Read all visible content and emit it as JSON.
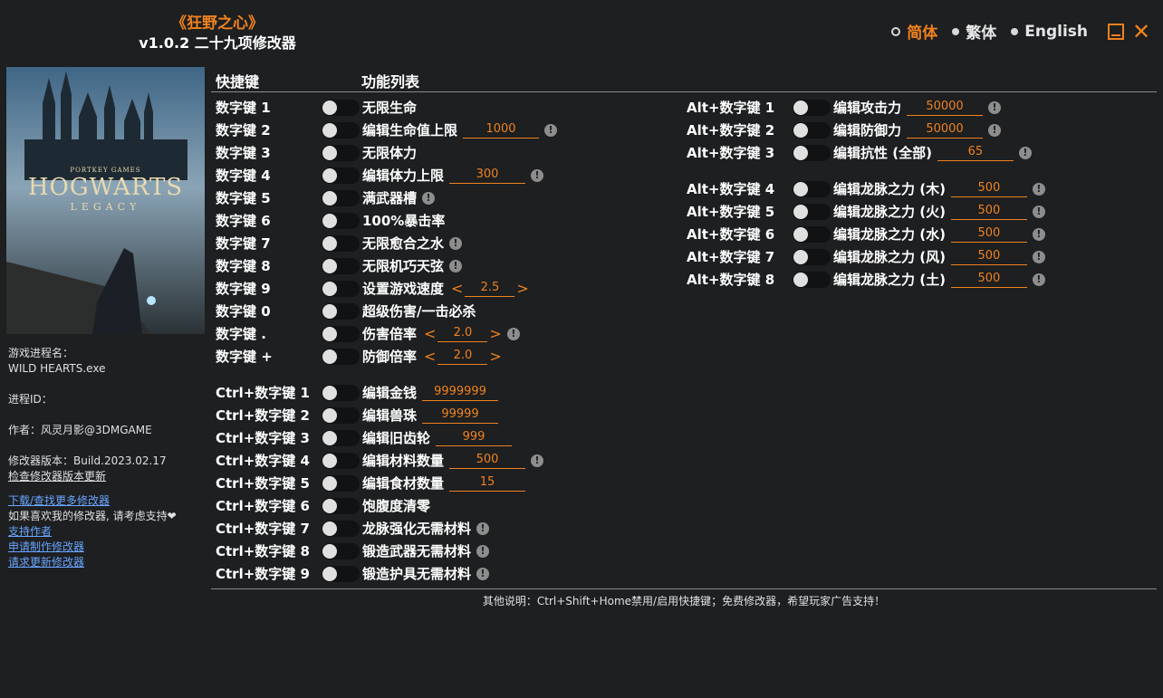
{
  "header": {
    "game_title": "《狂野之心》",
    "subtitle": "v1.0.2 二十九项修改器"
  },
  "languages": [
    "简体",
    "繁体",
    "English"
  ],
  "selected_language": "简体",
  "columns": {
    "hotkey": "快捷键",
    "features": "功能列表"
  },
  "sidebar": {
    "process_label": "游戏进程名：",
    "process_name": "WILD HEARTS.exe",
    "pid_label": "进程ID：",
    "author": "作者：风灵月影@3DMGAME",
    "version": "修改器版本：Build.2023.02.17",
    "check_update": "检查修改器版本更新",
    "download": "下载/查找更多修改器",
    "support_text": "如果喜欢我的修改器, 请考虑支持❤",
    "support_author": "支持作者",
    "request_trainer": "申请制作修改器",
    "request_update": "请求更新修改器"
  },
  "cheats_left": [
    {
      "key": "数字键 1",
      "name": "无限生命",
      "value": null,
      "info": false
    },
    {
      "key": "数字键 2",
      "name": "编辑生命值上限",
      "value": "1000",
      "info": true
    },
    {
      "key": "数字键 3",
      "name": "无限体力",
      "value": null,
      "info": false
    },
    {
      "key": "数字键 4",
      "name": "编辑体力上限",
      "value": "300",
      "info": true
    },
    {
      "key": "数字键 5",
      "name": "满武器槽",
      "value": null,
      "info": true
    },
    {
      "key": "数字键 6",
      "name": "100%暴击率",
      "value": null,
      "info": false
    },
    {
      "key": "数字键 7",
      "name": "无限愈合之水",
      "value": null,
      "info": true
    },
    {
      "key": "数字键 8",
      "name": "无限机巧天弦",
      "value": null,
      "info": true
    },
    {
      "key": "数字键 9",
      "name": "设置游戏速度",
      "stepper": "2.5",
      "info": false
    },
    {
      "key": "数字键 0",
      "name": "超级伤害/一击必杀",
      "value": null,
      "info": false
    },
    {
      "key": "数字键 .",
      "name": "伤害倍率",
      "stepper": "2.0",
      "info": true
    },
    {
      "key": "数字键 +",
      "name": "防御倍率",
      "stepper": "2.0",
      "info": false
    }
  ],
  "cheats_ctrl": [
    {
      "key": "Ctrl+数字键 1",
      "name": "编辑金钱",
      "value": "9999999",
      "info": false
    },
    {
      "key": "Ctrl+数字键 2",
      "name": "编辑兽珠",
      "value": "99999",
      "info": false
    },
    {
      "key": "Ctrl+数字键 3",
      "name": "编辑旧齿轮",
      "value": "999",
      "info": false
    },
    {
      "key": "Ctrl+数字键 4",
      "name": "编辑材料数量",
      "value": "500",
      "info": true
    },
    {
      "key": "Ctrl+数字键 5",
      "name": "编辑食材数量",
      "value": "15",
      "info": false
    },
    {
      "key": "Ctrl+数字键 6",
      "name": "饱腹度清零",
      "value": null,
      "info": false
    },
    {
      "key": "Ctrl+数字键 7",
      "name": "龙脉强化无需材料",
      "value": null,
      "info": true
    },
    {
      "key": "Ctrl+数字键 8",
      "name": "锻造武器无需材料",
      "value": null,
      "info": true
    },
    {
      "key": "Ctrl+数字键 9",
      "name": "锻造护具无需材料",
      "value": null,
      "info": true
    }
  ],
  "cheats_alt1": [
    {
      "key": "Alt+数字键 1",
      "name": "编辑攻击力",
      "value": "50000",
      "info": true
    },
    {
      "key": "Alt+数字键 2",
      "name": "编辑防御力",
      "value": "50000",
      "info": true
    },
    {
      "key": "Alt+数字键 3",
      "name": "编辑抗性 (全部)",
      "value": "65",
      "info": true
    }
  ],
  "cheats_alt2": [
    {
      "key": "Alt+数字键 4",
      "name": "编辑龙脉之力 (木)",
      "value": "500",
      "info": true
    },
    {
      "key": "Alt+数字键 5",
      "name": "编辑龙脉之力 (火)",
      "value": "500",
      "info": true
    },
    {
      "key": "Alt+数字键 6",
      "name": "编辑龙脉之力 (水)",
      "value": "500",
      "info": true
    },
    {
      "key": "Alt+数字键 7",
      "name": "编辑龙脉之力 (风)",
      "value": "500",
      "info": true
    },
    {
      "key": "Alt+数字键 8",
      "name": "编辑龙脉之力 (土)",
      "value": "500",
      "info": true
    }
  ],
  "footer": "其他说明：Ctrl+Shift+Home禁用/启用快捷键；免费修改器，希望玩家广告支持！",
  "colors": {
    "accent": "#f0821e",
    "background": "#1d1f21",
    "link": "#6aa5ff"
  },
  "cover_art_text": {
    "top": "PORTKEY GAMES",
    "title": "HOGWARTS",
    "sub": "LEGACY"
  }
}
